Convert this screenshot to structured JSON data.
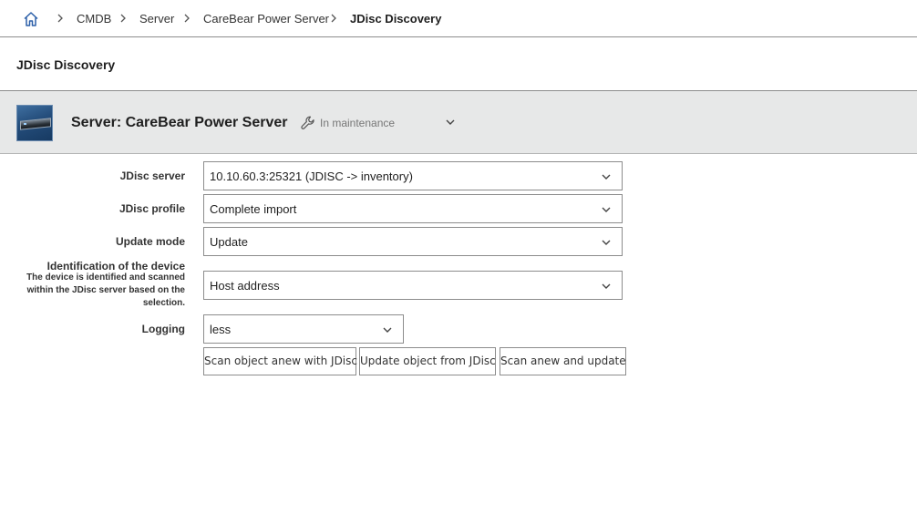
{
  "breadcrumb": {
    "home_icon": "home-icon",
    "items": [
      "CMDB",
      "Server",
      "CareBear Power Server"
    ],
    "current": "JDisc Discovery"
  },
  "page": {
    "title": "JDisc Discovery"
  },
  "object": {
    "thumbnail_icon": "server-icon",
    "title": "Server: CareBear Power Server",
    "status_icon": "wrench-icon",
    "status": "In maintenance"
  },
  "form": {
    "jdisc_server": {
      "label": "JDisc server",
      "value": "10.10.60.3:25321 (JDISC -> inventory)"
    },
    "jdisc_profile": {
      "label": "JDisc profile",
      "value": "Complete import"
    },
    "update_mode": {
      "label": "Update mode",
      "value": "Update"
    },
    "identification": {
      "label": "Identification of the device",
      "description_lines": [
        "The device is identified and scanned",
        "within the JDisc server based on the",
        "selection."
      ],
      "value": "Host address"
    },
    "logging": {
      "label": "Logging",
      "value": "less"
    }
  },
  "buttons": {
    "scan": "Scan object anew with JDisc",
    "update": "Update object from JDisc",
    "scan_update": "Scan anew and update"
  }
}
